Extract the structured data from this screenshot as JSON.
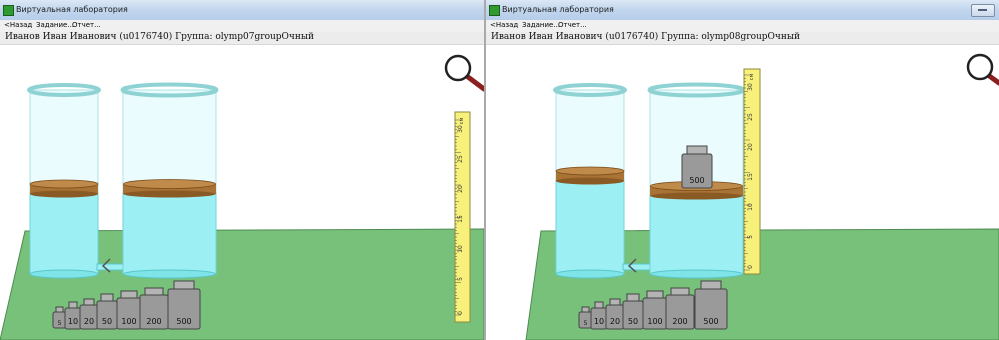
{
  "left": {
    "title": "Виртуальная лаборатория",
    "menu": {
      "back": "<Назад",
      "task": "Задание...",
      "report": "Отчет..."
    },
    "user_line": "Иванов Иван Иванович (u0176740)  Группа: olymp07groupОчный"
  },
  "right": {
    "title": "Виртуальная лаборатория",
    "menu": {
      "back": "<Назад",
      "task": "Задание...",
      "report": "Отчет..."
    },
    "user_line": "Иванов Иван Иванович (u0176740)  Группа: olymp08groupОчный"
  },
  "weights": {
    "w5": "5",
    "w10": "10",
    "w20": "20",
    "w50": "50",
    "w100": "100",
    "w200": "200",
    "w500": "500"
  },
  "ruler": {
    "ticks": [
      "30",
      "25",
      "20",
      "15",
      "10",
      "5",
      "0"
    ],
    "unit": "см"
  },
  "colors": {
    "table": "#77c17a",
    "water": "#9cf0f4",
    "piston": "#b07a3a",
    "glass": "#eafcfd",
    "rim": "#8fd2d4",
    "ruler": "#f7f07a"
  }
}
